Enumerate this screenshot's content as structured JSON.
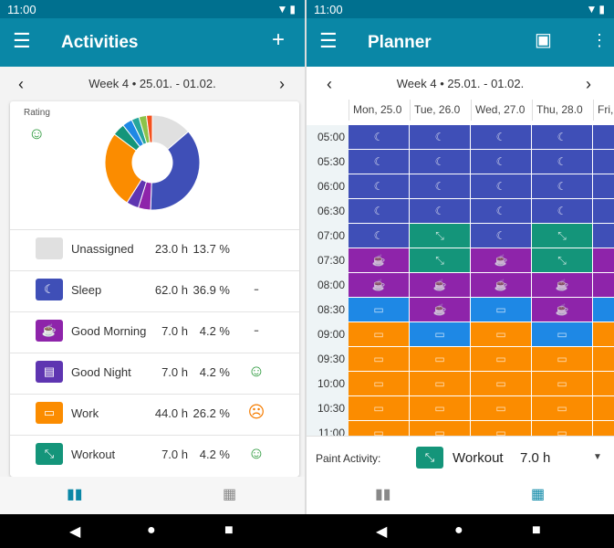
{
  "status": {
    "time_left": "11:00",
    "time_right": "11:00"
  },
  "left": {
    "title": "Activities",
    "week": "Week 4  •  25.01. - 01.02.",
    "rating_label": "Rating",
    "rating_icon": "smile-icon",
    "chart_data": {
      "type": "pie",
      "values": [
        13.7,
        36.9,
        4.2,
        4.2,
        26.2,
        4.2,
        3.4,
        2.6,
        2.6,
        2.0
      ],
      "colors": [
        "#e0e0e0",
        "#3f4fb7",
        "#8e24aa",
        "#5e35b1",
        "#fb8c00",
        "#14957a",
        "#1e88e5",
        "#26a69a",
        "#8bc34a",
        "#f4511e"
      ]
    },
    "activities": [
      {
        "name": "Unassigned",
        "hours": "23.0 h",
        "percent": "13.7 %",
        "color": "#e0e0e0",
        "icon": "",
        "rating": ""
      },
      {
        "name": "Sleep",
        "hours": "62.0 h",
        "percent": "36.9 %",
        "color": "#3f4fb7",
        "icon": "☾",
        "rating": "-"
      },
      {
        "name": "Good Morning",
        "hours": "7.0 h",
        "percent": "4.2 %",
        "color": "#8e24aa",
        "icon": "☕",
        "rating": "-"
      },
      {
        "name": "Good Night",
        "hours": "7.0 h",
        "percent": "4.2 %",
        "color": "#5e35b1",
        "icon": "▤",
        "rating": "☺"
      },
      {
        "name": "Work",
        "hours": "44.0 h",
        "percent": "26.2 %",
        "color": "#fb8c00",
        "icon": "▭",
        "rating": "☹"
      },
      {
        "name": "Workout",
        "hours": "7.0 h",
        "percent": "4.2 %",
        "color": "#14957a",
        "icon": "⤡",
        "rating": "☺"
      }
    ]
  },
  "right": {
    "title": "Planner",
    "week": "Week 4  •  25.01. - 01.02.",
    "days": [
      "Mon, 25.0",
      "Tue, 26.0",
      "Wed, 27.0",
      "Thu, 28.0",
      "Fri, 2"
    ],
    "times": [
      "05:00",
      "05:30",
      "06:00",
      "06:30",
      "07:00",
      "07:30",
      "08:00",
      "08:30",
      "09:00",
      "09:30",
      "10:00",
      "10:30",
      "11:00"
    ],
    "paint_label": "Paint Activity:",
    "paint_activity": "Workout",
    "paint_hours": "7.0 h"
  }
}
